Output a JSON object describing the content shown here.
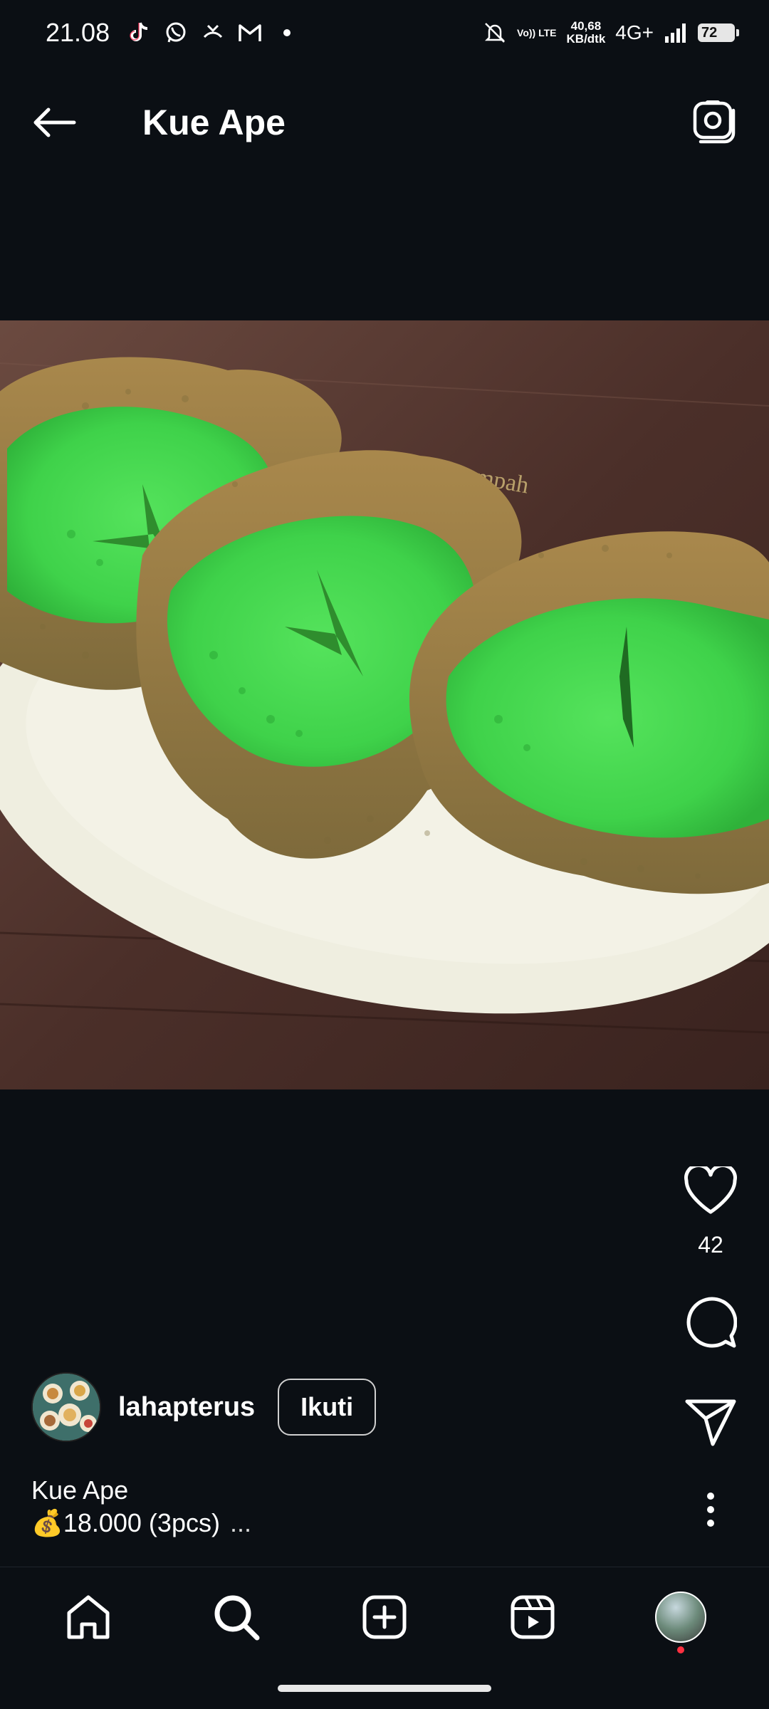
{
  "status_bar": {
    "time": "21.08",
    "icons_left": [
      "tiktok-icon",
      "whatsapp-icon",
      "missed-call-icon",
      "gmail-icon",
      "dot-icon"
    ],
    "volte": "Vo)) LTE",
    "speed_value": "40,68",
    "speed_unit": "KB/dtk",
    "network": "4G+",
    "battery": "72"
  },
  "header": {
    "title": "Kue Ape"
  },
  "post": {
    "image_icon": "kue-ape-photo",
    "likes": "42",
    "author": {
      "username": "lahapterus",
      "follow_label": "Ikuti"
    },
    "caption": {
      "line1": "Kue Ape",
      "line2": "💰18.000 (3pcs)",
      "more": "..."
    }
  },
  "nav": {
    "items": [
      "home-icon",
      "search-icon",
      "create-icon",
      "reels-icon",
      "profile-avatar"
    ]
  },
  "colors": {
    "background": "#0b0f14",
    "text": "#ffffff",
    "notification": "#ff3040",
    "kue_green": "#3fd24a"
  }
}
